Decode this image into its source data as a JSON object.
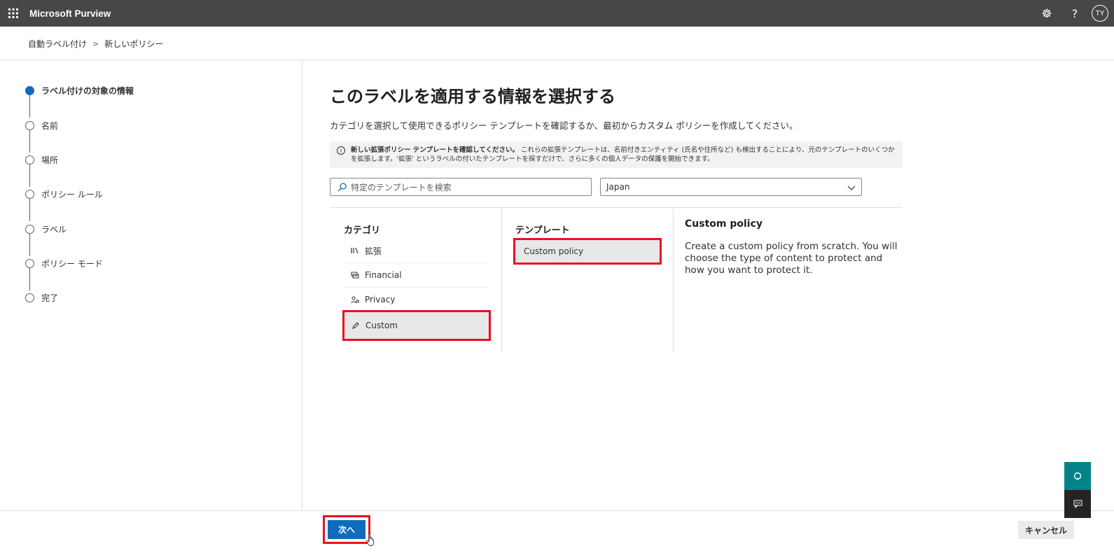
{
  "app": {
    "title": "Microsoft Purview",
    "avatar_initials": "TY"
  },
  "breadcrumb": {
    "parent": "自動ラベル付け",
    "current": "新しいポリシー"
  },
  "steps": [
    {
      "label": "ラベル付けの対象の情報",
      "active": true
    },
    {
      "label": "名前",
      "active": false
    },
    {
      "label": "場所",
      "active": false
    },
    {
      "label": "ポリシー ルール",
      "active": false
    },
    {
      "label": "ラベル",
      "active": false
    },
    {
      "label": "ポリシー モード",
      "active": false
    },
    {
      "label": "完了",
      "active": false
    }
  ],
  "main": {
    "title": "このラベルを適用する情報を選択する",
    "description": "カテゴリを選択して使用できるポリシー テンプレートを確認するか、最初からカスタム ポリシーを作成してください。",
    "info": {
      "strong": "新しい拡張ポリシー テンプレートを確認してください。",
      "text": "これらの拡張テンプレートは、名前付きエンティティ (氏名や住所など) も検出することにより、元のテンプレートのいくつかを拡張します。'拡張' というラベルの付いたテンプレートを探すだけで、さらに多くの個人データの保護を開始できます。"
    },
    "search_placeholder": "特定のテンプレートを検索",
    "region_selected": "Japan"
  },
  "categories": {
    "header": "カテゴリ",
    "items": [
      {
        "label": "拡張",
        "icon": "library-icon"
      },
      {
        "label": "Financial",
        "icon": "money-icon"
      },
      {
        "label": "Privacy",
        "icon": "person-lock-icon"
      },
      {
        "label": "Custom",
        "icon": "pencil-icon",
        "selected": true
      }
    ]
  },
  "templates": {
    "header": "テンプレート",
    "items": [
      {
        "label": "Custom policy",
        "selected": true
      }
    ]
  },
  "detail": {
    "title": "Custom policy",
    "description": "Create a custom policy from scratch. You will choose the type of content to protect and how you want to protect it."
  },
  "footer": {
    "next_label": "次へ",
    "cancel_label": "キャンセル"
  },
  "colors": {
    "accent": "#0f6cbd",
    "highlight": "#e81123",
    "topbar": "#474747"
  }
}
